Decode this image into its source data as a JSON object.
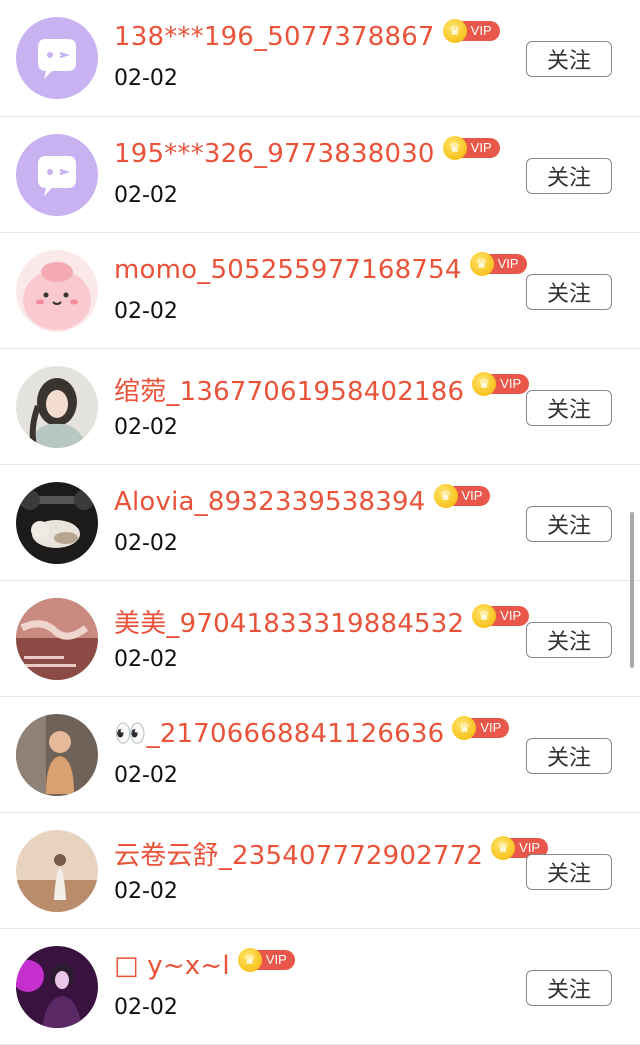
{
  "follow_label": "关注",
  "vip_label": "VIP",
  "colors": {
    "name": "#e8533a",
    "vip_badge": "#e9574a",
    "crown": "#f5b400"
  },
  "users": [
    {
      "name": "138***196_5077378867",
      "date": "02-02",
      "avatar": "chat-bubble-avatar"
    },
    {
      "name": "195***326_9773838030",
      "date": "02-02",
      "avatar": "chat-bubble-avatar"
    },
    {
      "name": "momo_505255977168754",
      "date": "02-02",
      "avatar": "cartoon-pink-avatar"
    },
    {
      "name": "绾菀_13677061958402186",
      "date": "02-02",
      "avatar": "portrait-avatar"
    },
    {
      "name": "Alovia_8932339538394",
      "date": "02-02",
      "avatar": "cat-dumbbell-avatar"
    },
    {
      "name": "美美_97041833319884532",
      "date": "02-02",
      "avatar": "photo-avatar"
    },
    {
      "name": "👀_21706668841126636",
      "date": "02-02",
      "avatar": "toddler-avatar"
    },
    {
      "name": "云卷云舒_235407772902772",
      "date": "02-02",
      "avatar": "field-girl-avatar"
    },
    {
      "name": "□ y~x~l",
      "date": "02-02",
      "avatar": "purple-girl-avatar"
    }
  ]
}
